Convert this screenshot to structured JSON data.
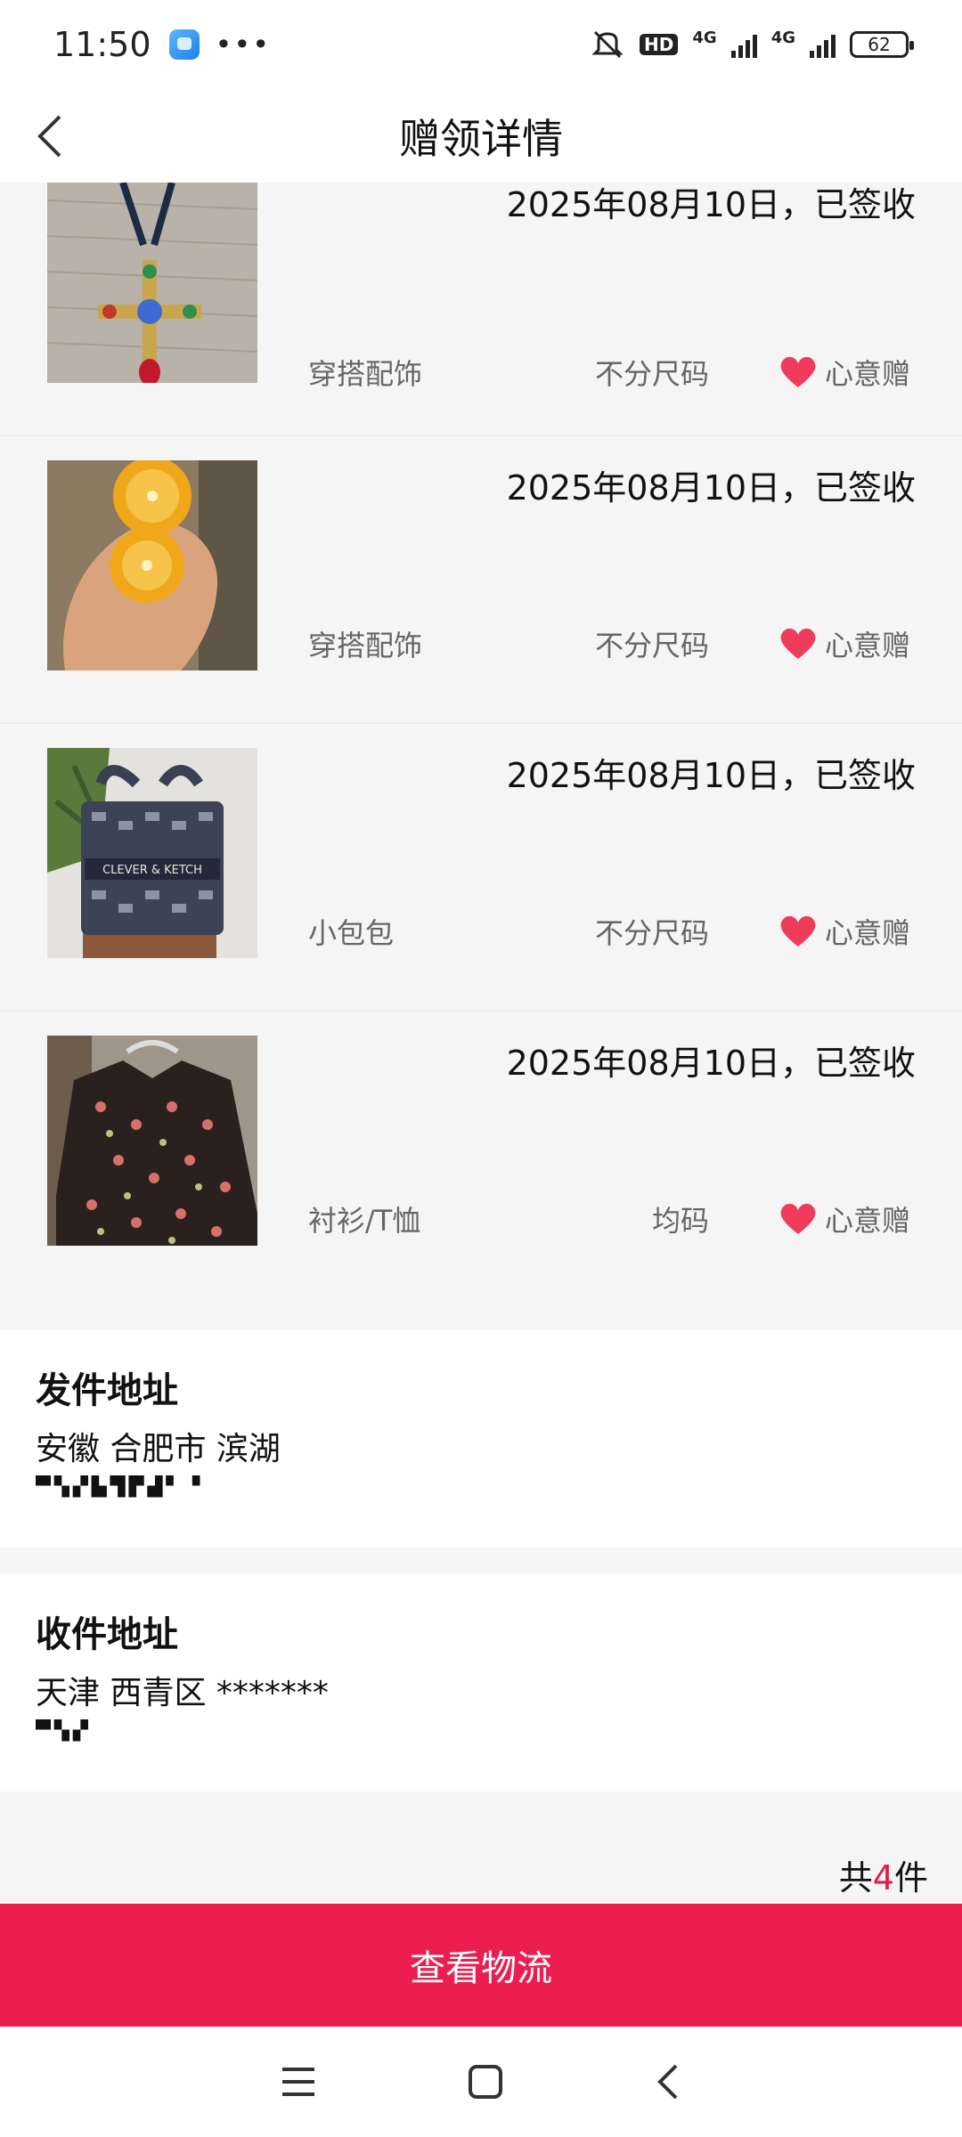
{
  "status_bar": {
    "time": "11:50",
    "dots": "•••",
    "battery": "62",
    "network1": "4G",
    "network2": "4G",
    "hd": "HD"
  },
  "header": {
    "title": "赠领详情"
  },
  "items": [
    {
      "date": "2025年08月10日，已签收",
      "category": "穿搭配饰",
      "size": "不分尺码",
      "tag": "心意赠"
    },
    {
      "date": "2025年08月10日，已签收",
      "category": "穿搭配饰",
      "size": "不分尺码",
      "tag": "心意赠"
    },
    {
      "date": "2025年08月10日，已签收",
      "category": "小包包",
      "size": "不分尺码",
      "tag": "心意赠",
      "bag_text": "CLEVER & KETCH"
    },
    {
      "date": "2025年08月10日，已签收",
      "category": "衬衫/T恤",
      "size": "均码",
      "tag": "心意赠"
    }
  ],
  "sender": {
    "title": "发件地址",
    "address": "安徽 合肥市 滨湖"
  },
  "receiver": {
    "title": "收件地址",
    "address": "天津 西青区 *******"
  },
  "total": {
    "prefix": "共",
    "count": "4",
    "suffix": "件"
  },
  "button": {
    "label": "查看物流"
  },
  "colors": {
    "accent": "#ec1e4f",
    "heart": "#ee3c5a"
  }
}
